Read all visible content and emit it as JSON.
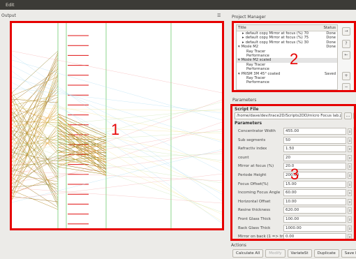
{
  "menubar": {
    "edit_label": "Edit"
  },
  "output": {
    "label": "Output",
    "expand_glyph": "☰"
  },
  "annotations": {
    "one": "1",
    "two": "2",
    "three": "3"
  },
  "project_manager": {
    "label": "Project Manager",
    "col_title": "Title",
    "col_status": "Status",
    "rows": [
      {
        "title": "default copy Mirror at focus (%) 70",
        "status": "Done",
        "indent": 1,
        "arrow": "▸"
      },
      {
        "title": "default copy Mirror at focus (%) 75",
        "status": "Done",
        "indent": 1,
        "arrow": "▸"
      },
      {
        "title": "default copy Mirror at focus (%) 30",
        "status": "Done",
        "indent": 1,
        "arrow": "▸"
      },
      {
        "title": "Mosle M2",
        "status": "Done",
        "indent": 0,
        "arrow": "▾"
      },
      {
        "title": "Ray Tracer",
        "status": "",
        "indent": 2,
        "arrow": ""
      },
      {
        "title": "Performance",
        "status": "",
        "indent": 2,
        "arrow": ""
      },
      {
        "title": "Mosle M2 scaled",
        "status": "",
        "indent": 0,
        "arrow": "▾"
      },
      {
        "title": "Ray Tracer",
        "status": "",
        "indent": 2,
        "arrow": ""
      },
      {
        "title": "Performance",
        "status": "",
        "indent": 2,
        "arrow": ""
      },
      {
        "title": "PRISM 3M 45° coated",
        "status": "Saved",
        "indent": 0,
        "arrow": "▾"
      },
      {
        "title": "Ray Tracer",
        "status": "",
        "indent": 2,
        "arrow": ""
      },
      {
        "title": "Performance",
        "status": "",
        "indent": 2,
        "arrow": ""
      }
    ],
    "buttons": {
      "add": "+",
      "help": "?",
      "remove": "−"
    }
  },
  "parameters": {
    "label": "Parameters",
    "script_file_title": "Script File",
    "script_path": "/home/dave/dev/trace2D/Scripts2DD/micro Focus lab.js",
    "browse_label": "...",
    "edit_label": "✎",
    "params_title": "Parameters",
    "items": [
      {
        "name": "Concentrator Width",
        "value": "455.00"
      },
      {
        "name": "Sub segments",
        "value": "50"
      },
      {
        "name": "Refractiv index",
        "value": "1.50"
      },
      {
        "name": "count",
        "value": "20"
      },
      {
        "name": "Mirror at focus (%)",
        "value": "20.0"
      },
      {
        "name": "Periode Height",
        "value": "200.00"
      },
      {
        "name": "Focus Offset(%)",
        "value": "15.00"
      },
      {
        "name": "Incoming Focus Angle",
        "value": "60.00"
      },
      {
        "name": "Horizontal Offset",
        "value": "10.00"
      },
      {
        "name": "Resine thickness",
        "value": "620.00"
      },
      {
        "name": "Front Glass Thick",
        "value": "100.00"
      },
      {
        "name": "Back Glass Thick",
        "value": "1000.00"
      },
      {
        "name": "Mirror on back (1 => true)",
        "value": "0.00"
      }
    ]
  },
  "actions": {
    "label": "Actions",
    "calculate_all": "Calculate All",
    "modify": "Modify",
    "variatest": "VariateSt",
    "duplicate": "Duplicate",
    "save_report": "Save Report"
  }
}
